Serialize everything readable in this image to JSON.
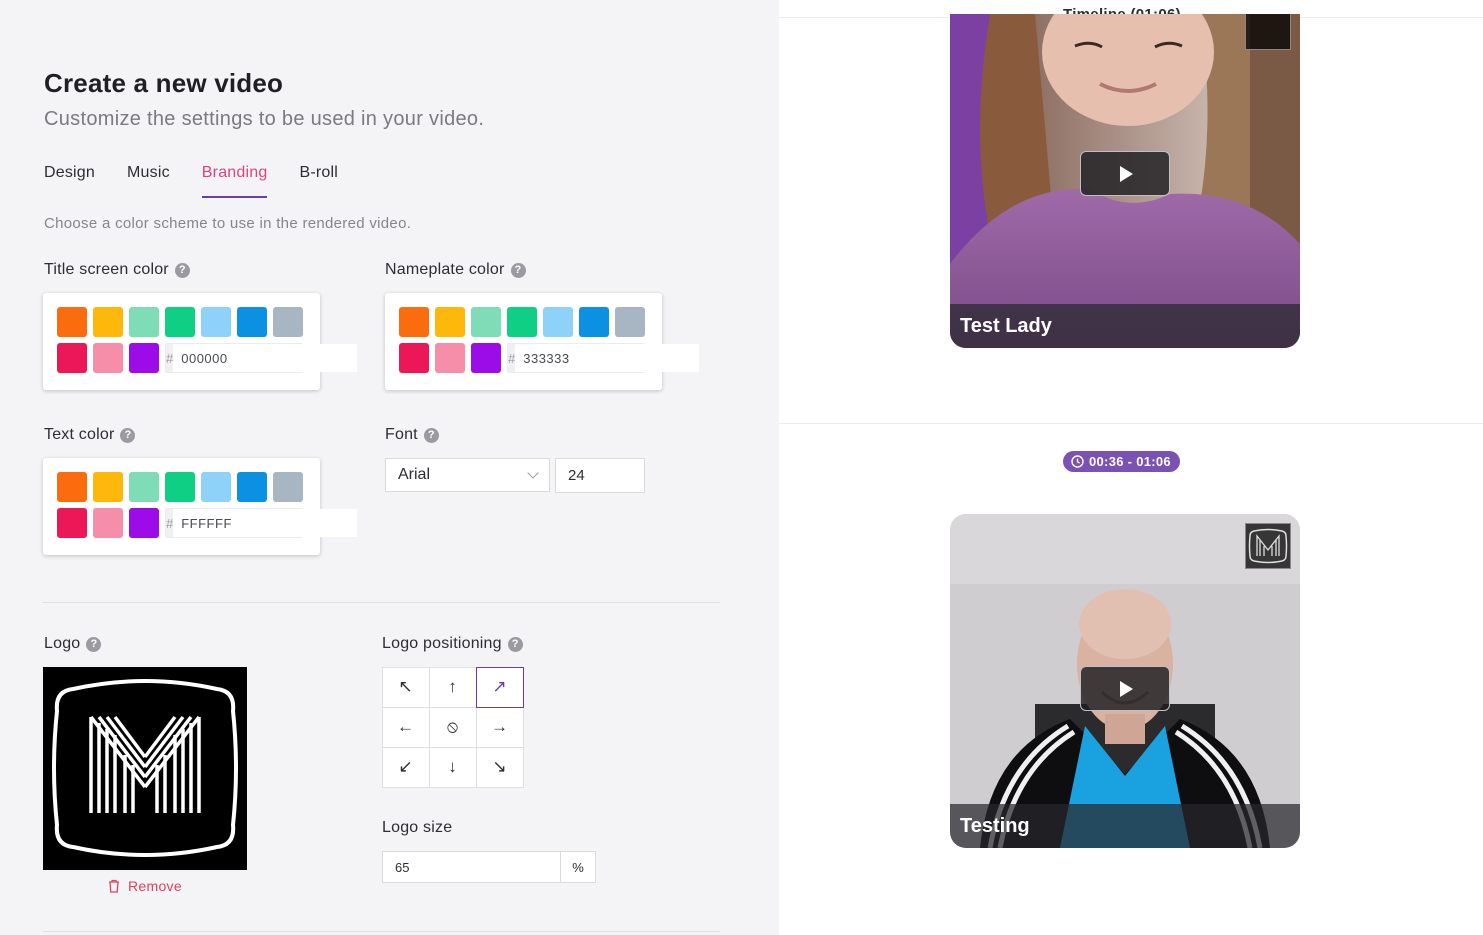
{
  "header": {
    "title": "Create a new video",
    "subtitle": "Customize the settings to be used in your video."
  },
  "tabs": [
    {
      "label": "Design",
      "active": false
    },
    {
      "label": "Music",
      "active": false
    },
    {
      "label": "Branding",
      "active": true
    },
    {
      "label": "B-roll",
      "active": false
    }
  ],
  "hint": "Choose a color scheme to use in the rendered video.",
  "swatches_row1": [
    "#fa6c0e",
    "#fdb80b",
    "#7edcb6",
    "#0ecf84",
    "#8ed2f9",
    "#0c90e2",
    "#a8b5c3"
  ],
  "swatches_row2": [
    "#ec1756",
    "#f78ea9",
    "#9b0ce9"
  ],
  "title_screen_color": {
    "label": "Title screen color",
    "hash": "#",
    "value": "000000"
  },
  "nameplate_color": {
    "label": "Nameplate color",
    "hash": "#",
    "value": "333333"
  },
  "text_color": {
    "label": "Text color",
    "hash": "#",
    "value": "FFFFFF"
  },
  "font": {
    "label": "Font",
    "family": "Arial",
    "size": "24"
  },
  "logo": {
    "label": "Logo",
    "remove_label": "Remove"
  },
  "logo_positioning": {
    "label": "Logo positioning",
    "cells": [
      "↖",
      "↑",
      "↗",
      "←",
      "⦸",
      "→",
      "↙",
      "↓",
      "↘"
    ],
    "names": [
      "top-left",
      "top",
      "top-right",
      "left",
      "none",
      "right",
      "bottom-left",
      "bottom",
      "bottom-right"
    ],
    "selected": "top-right"
  },
  "logo_size": {
    "label": "Logo size",
    "value": "65",
    "unit": "%"
  },
  "help_glyph": "?",
  "timeline": {
    "title": "Timeline (01:06)",
    "clips": [
      {
        "name": "Test Lady"
      },
      {
        "name": "Testing",
        "time_range": "00:36 - 01:06"
      }
    ]
  },
  "colors": {
    "accent_pink": "#e0427f",
    "accent_purple": "#6b3fa0",
    "badge": "#7a52b3",
    "remove_red": "#e0425a"
  }
}
